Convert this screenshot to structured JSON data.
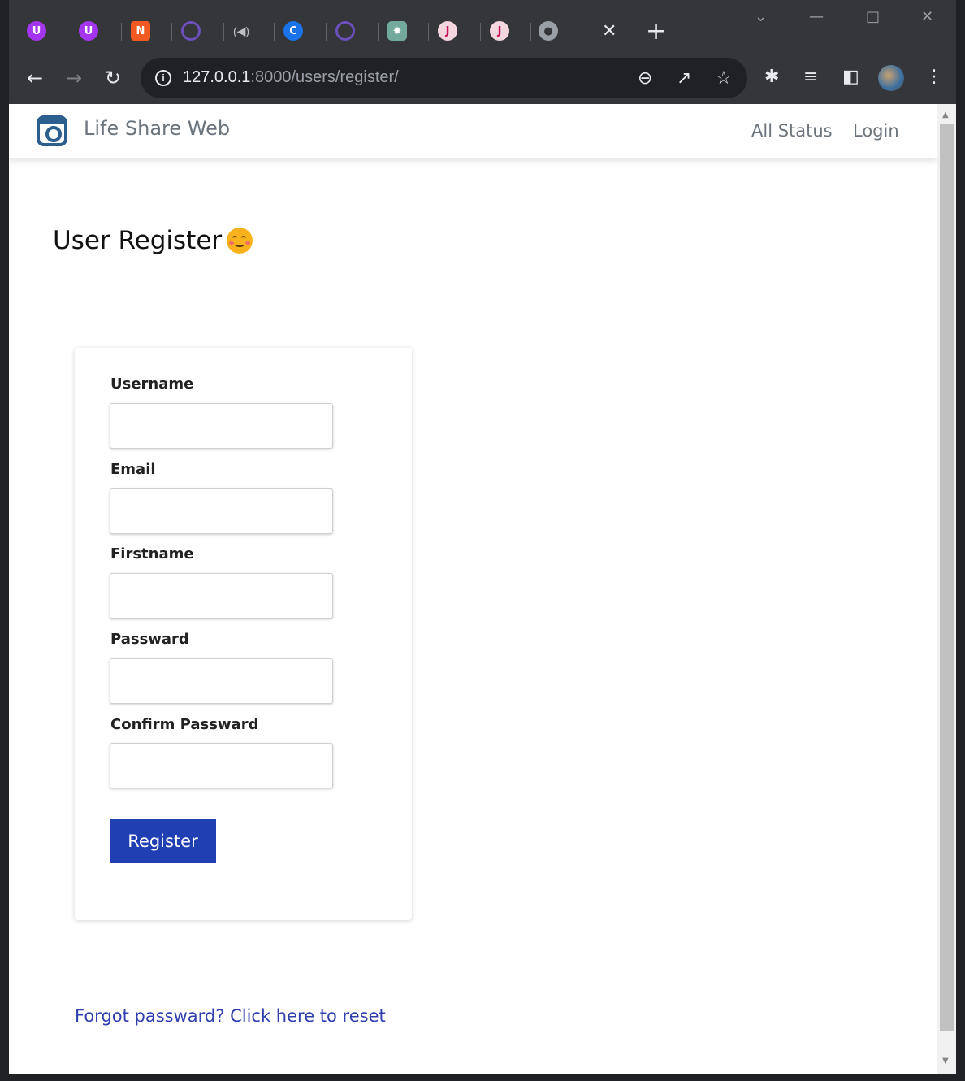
{
  "browser": {
    "tabs": [
      {
        "icon": "U",
        "color": "#a435f0"
      },
      {
        "icon": "U",
        "color": "#a435f0"
      },
      {
        "icon": "N",
        "color": "#f05a22"
      },
      {
        "icon": "O",
        "color": "#6b4fbb"
      },
      {
        "icon": "speaker",
        "color": "#35363a"
      },
      {
        "icon": "C",
        "color": "#1a73e8"
      },
      {
        "icon": "O",
        "color": "#6b4fbb"
      },
      {
        "icon": "G",
        "color": "#74aa9c"
      },
      {
        "icon": "J",
        "color": "#c2185b"
      },
      {
        "icon": "J",
        "color": "#c2185b"
      },
      {
        "icon": "globe",
        "color": "#9aa0a6"
      }
    ],
    "url_host": "127.0.0.1",
    "url_rest": ":8000/users/register/"
  },
  "navbar": {
    "brand": "Life Share Web",
    "links": [
      "All Status",
      "Login"
    ]
  },
  "page": {
    "heading": "User Register",
    "form": {
      "fields": [
        "Username",
        "Email",
        "Firstname",
        "Passward",
        "Confirm Passward"
      ],
      "submit": "Register"
    },
    "forgot_link": "Forgot passward? Click here to reset"
  },
  "colors": {
    "primary_button": "#1f3fb2",
    "link": "#2f3fae",
    "brand_icon": "#2c5e8e"
  }
}
